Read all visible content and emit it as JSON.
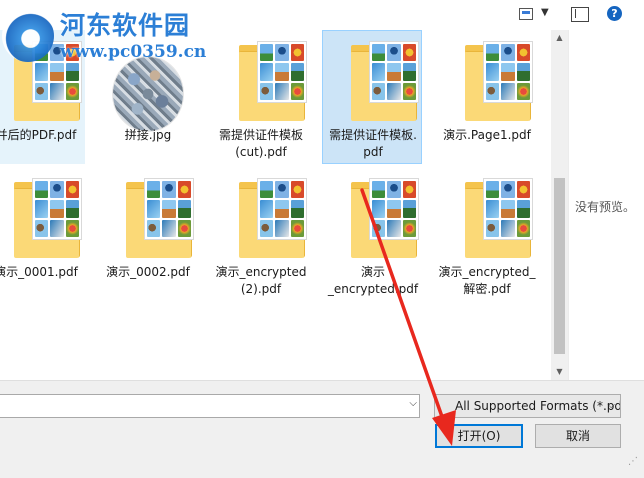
{
  "watermark": {
    "title": "河东软件园",
    "url": "www.pc0359.cn"
  },
  "files": [
    {
      "name": "并后的PDF.pdf",
      "kind": "folder"
    },
    {
      "name": "拼接.jpg",
      "kind": "collage"
    },
    {
      "name": "需提供证件模板\n(cut).pdf",
      "kind": "folder"
    },
    {
      "name": "需提供证件模板.\npdf",
      "kind": "folder",
      "selected": true
    },
    {
      "name": "演示.Page1.pdf",
      "kind": "folder"
    },
    {
      "name": "演示_0001.pdf",
      "kind": "folder"
    },
    {
      "name": "演示_0002.pdf",
      "kind": "folder"
    },
    {
      "name": "演示_encrypted\n(2).pdf",
      "kind": "folder"
    },
    {
      "name": "演示\n_encrypted.pdf",
      "kind": "folder"
    },
    {
      "name": "演示_encrypted_\n解密.pdf",
      "kind": "folder"
    }
  ],
  "preview": {
    "empty_text": "没有预览。"
  },
  "filename_field": {
    "value": ""
  },
  "file_type": {
    "selected": "All Supported Formats (*.pd"
  },
  "buttons": {
    "open": "打开(O)",
    "cancel": "取消"
  },
  "toolbar": {
    "help_glyph": "?"
  },
  "colors": {
    "accent": "#0078d7",
    "selection": "#cce4f7",
    "annotation_arrow": "#e8281e"
  }
}
